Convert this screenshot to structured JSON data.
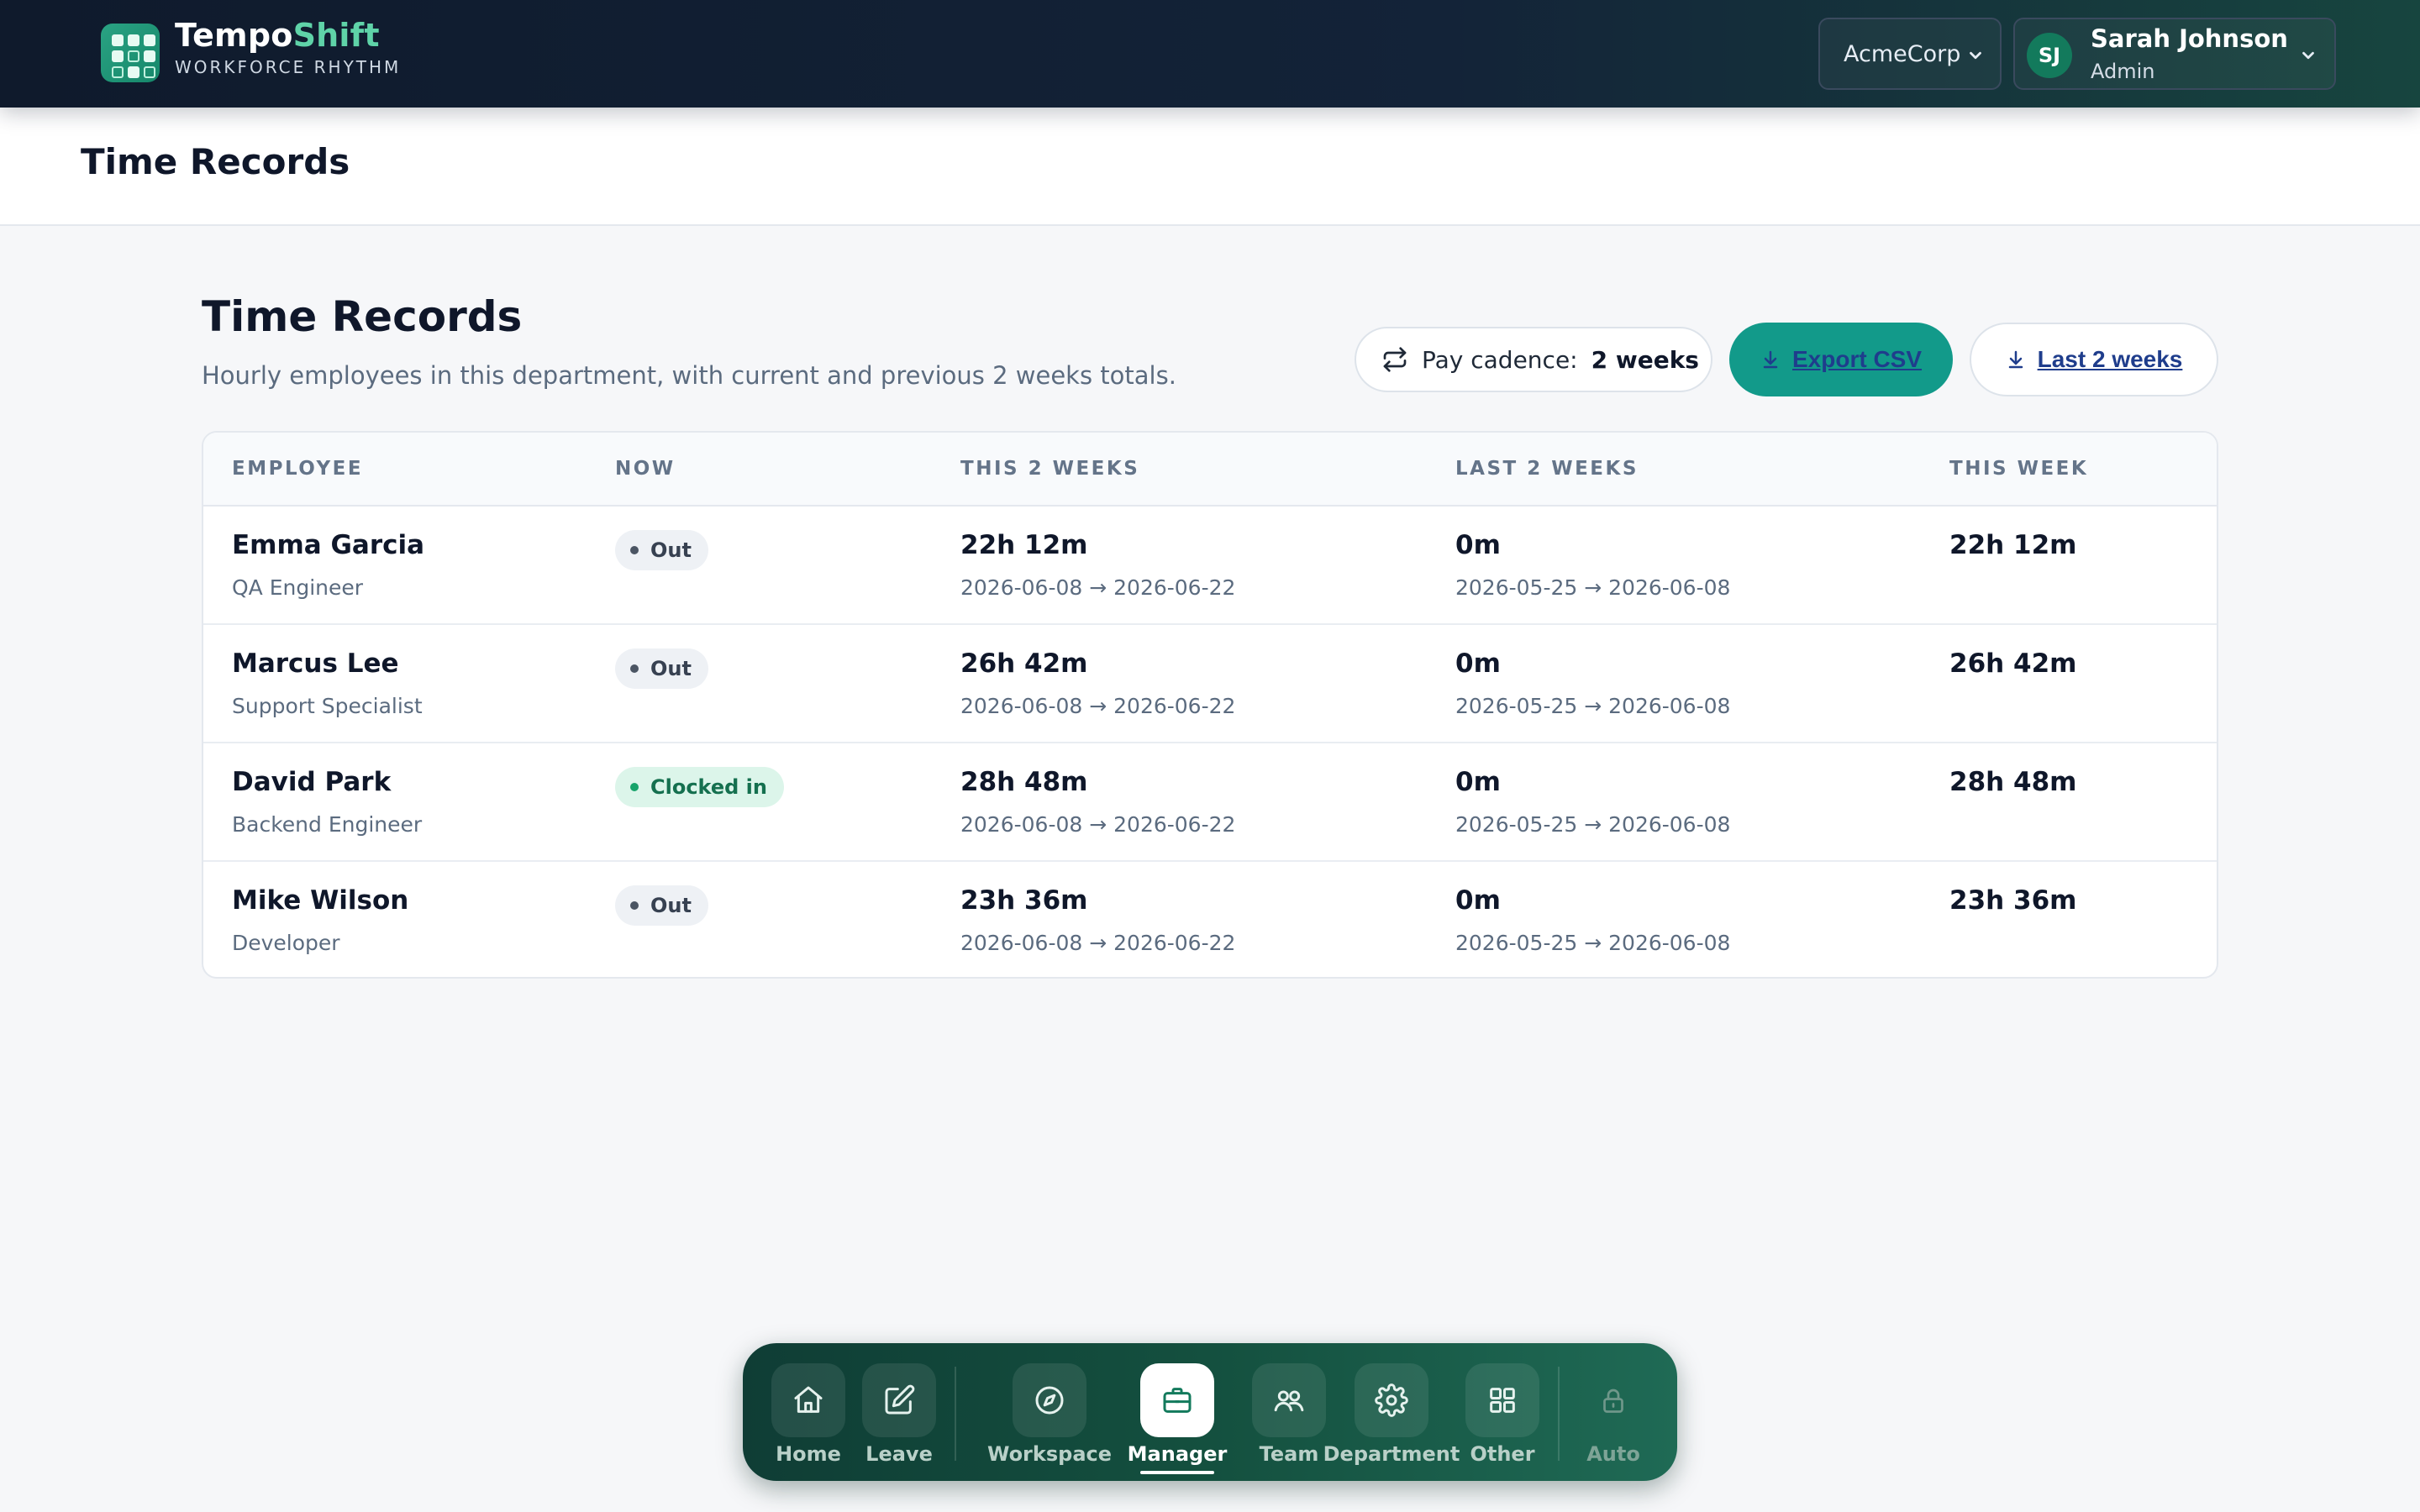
{
  "app": {
    "brand_primary": "Tempo",
    "brand_accent": "Shift",
    "tagline": "WORKFORCE RHYTHM",
    "accent_color": "#129a8a"
  },
  "topbar": {
    "org": "AcmeCorp",
    "user_initials": "SJ",
    "user_name": "Sarah Johnson",
    "user_role": "Admin"
  },
  "page": {
    "title": "Time Records"
  },
  "section": {
    "title": "Time Records",
    "subtitle": "Hourly employees in this department, with current and previous 2 weeks totals.",
    "cadence_label": "Pay cadence:",
    "cadence_value": "2 weeks",
    "export_label": "Export CSV",
    "last_label": "Last 2 weeks"
  },
  "table": {
    "headers": [
      "EMPLOYEE",
      "NOW",
      "THIS 2 WEEKS",
      "LAST 2 WEEKS",
      "THIS WEEK"
    ],
    "rows": [
      {
        "name": "Emma Garcia",
        "role": "QA Engineer",
        "status": "Out",
        "this2": "22h 12m",
        "this2_range": "2026-06-08 → 2026-06-22",
        "last2": "0m",
        "last2_range": "2026-05-25 → 2026-06-08",
        "week": "22h 12m"
      },
      {
        "name": "Marcus Lee",
        "role": "Support Specialist",
        "status": "Out",
        "this2": "26h 42m",
        "this2_range": "2026-06-08 → 2026-06-22",
        "last2": "0m",
        "last2_range": "2026-05-25 → 2026-06-08",
        "week": "26h 42m"
      },
      {
        "name": "David Park",
        "role": "Backend Engineer",
        "status": "Clocked in",
        "this2": "28h 48m",
        "this2_range": "2026-06-08 → 2026-06-22",
        "last2": "0m",
        "last2_range": "2026-05-25 → 2026-06-08",
        "week": "28h 48m"
      },
      {
        "name": "Mike Wilson",
        "role": "Developer",
        "status": "Out",
        "this2": "23h 36m",
        "this2_range": "2026-06-08 → 2026-06-22",
        "last2": "0m",
        "last2_range": "2026-05-25 → 2026-06-08",
        "week": "23h 36m"
      }
    ]
  },
  "nav": {
    "items": [
      {
        "label": "Home",
        "icon": "home-icon"
      },
      {
        "label": "Leave",
        "icon": "edit-icon"
      },
      {
        "label": "Workspace",
        "icon": "compass-icon"
      },
      {
        "label": "Manager",
        "icon": "briefcase-icon",
        "active": true
      },
      {
        "label": "Team",
        "icon": "users-icon"
      },
      {
        "label": "Department",
        "icon": "gear-icon"
      },
      {
        "label": "Other",
        "icon": "grid-icon"
      },
      {
        "label": "Auto",
        "icon": "lock-icon"
      }
    ]
  }
}
